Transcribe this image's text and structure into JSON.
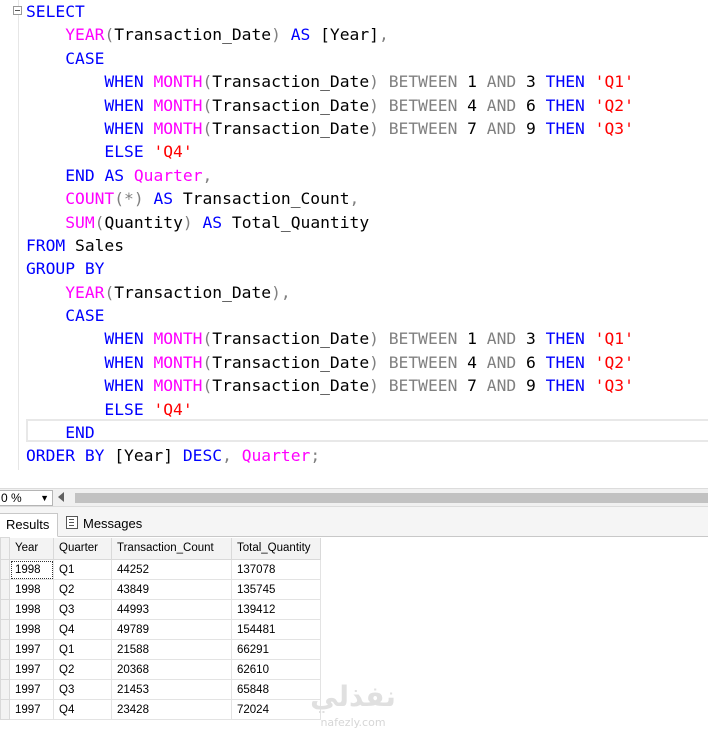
{
  "editor": {
    "lines": [
      [
        {
          "t": "SELECT",
          "c": "kw"
        }
      ],
      [
        {
          "t": "    "
        },
        {
          "t": "YEAR",
          "c": "fn"
        },
        {
          "t": "(",
          "c": "op"
        },
        {
          "t": "Transaction_Date"
        },
        {
          "t": ")",
          "c": "op"
        },
        {
          "t": " "
        },
        {
          "t": "AS",
          "c": "kw"
        },
        {
          "t": " [Year]"
        },
        {
          "t": ",",
          "c": "op"
        }
      ],
      [
        {
          "t": "    "
        },
        {
          "t": "CASE",
          "c": "kw"
        }
      ],
      [
        {
          "t": "        "
        },
        {
          "t": "WHEN",
          "c": "kw"
        },
        {
          "t": " "
        },
        {
          "t": "MONTH",
          "c": "fn"
        },
        {
          "t": "(",
          "c": "op"
        },
        {
          "t": "Transaction_Date"
        },
        {
          "t": ")",
          "c": "op"
        },
        {
          "t": " "
        },
        {
          "t": "BETWEEN",
          "c": "op"
        },
        {
          "t": " 1 "
        },
        {
          "t": "AND",
          "c": "op"
        },
        {
          "t": " 3 "
        },
        {
          "t": "THEN",
          "c": "kw"
        },
        {
          "t": " "
        },
        {
          "t": "'Q1'",
          "c": "str"
        }
      ],
      [
        {
          "t": "        "
        },
        {
          "t": "WHEN",
          "c": "kw"
        },
        {
          "t": " "
        },
        {
          "t": "MONTH",
          "c": "fn"
        },
        {
          "t": "(",
          "c": "op"
        },
        {
          "t": "Transaction_Date"
        },
        {
          "t": ")",
          "c": "op"
        },
        {
          "t": " "
        },
        {
          "t": "BETWEEN",
          "c": "op"
        },
        {
          "t": " 4 "
        },
        {
          "t": "AND",
          "c": "op"
        },
        {
          "t": " 6 "
        },
        {
          "t": "THEN",
          "c": "kw"
        },
        {
          "t": " "
        },
        {
          "t": "'Q2'",
          "c": "str"
        }
      ],
      [
        {
          "t": "        "
        },
        {
          "t": "WHEN",
          "c": "kw"
        },
        {
          "t": " "
        },
        {
          "t": "MONTH",
          "c": "fn"
        },
        {
          "t": "(",
          "c": "op"
        },
        {
          "t": "Transaction_Date"
        },
        {
          "t": ")",
          "c": "op"
        },
        {
          "t": " "
        },
        {
          "t": "BETWEEN",
          "c": "op"
        },
        {
          "t": " 7 "
        },
        {
          "t": "AND",
          "c": "op"
        },
        {
          "t": " 9 "
        },
        {
          "t": "THEN",
          "c": "kw"
        },
        {
          "t": " "
        },
        {
          "t": "'Q3'",
          "c": "str"
        }
      ],
      [
        {
          "t": "        "
        },
        {
          "t": "ELSE",
          "c": "kw"
        },
        {
          "t": " "
        },
        {
          "t": "'Q4'",
          "c": "str"
        }
      ],
      [
        {
          "t": "    "
        },
        {
          "t": "END",
          "c": "kw"
        },
        {
          "t": " "
        },
        {
          "t": "AS",
          "c": "kw"
        },
        {
          "t": " "
        },
        {
          "t": "Quarter",
          "c": "fn"
        },
        {
          "t": ",",
          "c": "op"
        }
      ],
      [
        {
          "t": "    "
        },
        {
          "t": "COUNT",
          "c": "fn"
        },
        {
          "t": "(*)",
          "c": "op"
        },
        {
          "t": " "
        },
        {
          "t": "AS",
          "c": "kw"
        },
        {
          "t": " Transaction_Count"
        },
        {
          "t": ",",
          "c": "op"
        }
      ],
      [
        {
          "t": "    "
        },
        {
          "t": "SUM",
          "c": "fn"
        },
        {
          "t": "(",
          "c": "op"
        },
        {
          "t": "Quantity"
        },
        {
          "t": ")",
          "c": "op"
        },
        {
          "t": " "
        },
        {
          "t": "AS",
          "c": "kw"
        },
        {
          "t": " Total_Quantity"
        }
      ],
      [
        {
          "t": "FROM",
          "c": "kw"
        },
        {
          "t": " Sales"
        }
      ],
      [
        {
          "t": "GROUP BY",
          "c": "kw"
        }
      ],
      [
        {
          "t": "    "
        },
        {
          "t": "YEAR",
          "c": "fn"
        },
        {
          "t": "(",
          "c": "op"
        },
        {
          "t": "Transaction_Date"
        },
        {
          "t": ")",
          "c": "op"
        },
        {
          "t": ",",
          "c": "op"
        }
      ],
      [
        {
          "t": "    "
        },
        {
          "t": "CASE",
          "c": "kw"
        }
      ],
      [
        {
          "t": "        "
        },
        {
          "t": "WHEN",
          "c": "kw"
        },
        {
          "t": " "
        },
        {
          "t": "MONTH",
          "c": "fn"
        },
        {
          "t": "(",
          "c": "op"
        },
        {
          "t": "Transaction_Date"
        },
        {
          "t": ")",
          "c": "op"
        },
        {
          "t": " "
        },
        {
          "t": "BETWEEN",
          "c": "op"
        },
        {
          "t": " 1 "
        },
        {
          "t": "AND",
          "c": "op"
        },
        {
          "t": " 3 "
        },
        {
          "t": "THEN",
          "c": "kw"
        },
        {
          "t": " "
        },
        {
          "t": "'Q1'",
          "c": "str"
        }
      ],
      [
        {
          "t": "        "
        },
        {
          "t": "WHEN",
          "c": "kw"
        },
        {
          "t": " "
        },
        {
          "t": "MONTH",
          "c": "fn"
        },
        {
          "t": "(",
          "c": "op"
        },
        {
          "t": "Transaction_Date"
        },
        {
          "t": ")",
          "c": "op"
        },
        {
          "t": " "
        },
        {
          "t": "BETWEEN",
          "c": "op"
        },
        {
          "t": " 4 "
        },
        {
          "t": "AND",
          "c": "op"
        },
        {
          "t": " 6 "
        },
        {
          "t": "THEN",
          "c": "kw"
        },
        {
          "t": " "
        },
        {
          "t": "'Q2'",
          "c": "str"
        }
      ],
      [
        {
          "t": "        "
        },
        {
          "t": "WHEN",
          "c": "kw"
        },
        {
          "t": " "
        },
        {
          "t": "MONTH",
          "c": "fn"
        },
        {
          "t": "(",
          "c": "op"
        },
        {
          "t": "Transaction_Date"
        },
        {
          "t": ")",
          "c": "op"
        },
        {
          "t": " "
        },
        {
          "t": "BETWEEN",
          "c": "op"
        },
        {
          "t": " 7 "
        },
        {
          "t": "AND",
          "c": "op"
        },
        {
          "t": " 9 "
        },
        {
          "t": "THEN",
          "c": "kw"
        },
        {
          "t": " "
        },
        {
          "t": "'Q3'",
          "c": "str"
        }
      ],
      [
        {
          "t": "        "
        },
        {
          "t": "ELSE",
          "c": "kw"
        },
        {
          "t": " "
        },
        {
          "t": "'Q4'",
          "c": "str"
        }
      ],
      [
        {
          "t": "    "
        },
        {
          "t": "END",
          "c": "kw"
        }
      ],
      [
        {
          "t": "ORDER BY",
          "c": "kw"
        },
        {
          "t": " [Year] "
        },
        {
          "t": "DESC",
          "c": "kw"
        },
        {
          "t": ",",
          "c": "op"
        },
        {
          "t": " "
        },
        {
          "t": "Quarter",
          "c": "fn"
        },
        {
          "t": ";",
          "c": "op"
        }
      ]
    ]
  },
  "zoom": {
    "value": "0 %"
  },
  "tabs": {
    "results_label": "Results",
    "messages_label": "Messages"
  },
  "results": {
    "columns": [
      "Year",
      "Quarter",
      "Transaction_Count",
      "Total_Quantity"
    ],
    "rows": [
      [
        "1998",
        "Q1",
        "44252",
        "137078"
      ],
      [
        "1998",
        "Q2",
        "43849",
        "135745"
      ],
      [
        "1998",
        "Q3",
        "44993",
        "139412"
      ],
      [
        "1998",
        "Q4",
        "49789",
        "154481"
      ],
      [
        "1997",
        "Q1",
        "21588",
        "66291"
      ],
      [
        "1997",
        "Q2",
        "20368",
        "62610"
      ],
      [
        "1997",
        "Q3",
        "21453",
        "65848"
      ],
      [
        "1997",
        "Q4",
        "23428",
        "72024"
      ]
    ]
  },
  "watermark": {
    "text": "نفذلي",
    "sub": "nafezly.com"
  },
  "colors": {
    "keyword": "#0000ff",
    "function": "#ff00ff",
    "operator": "#808080",
    "string": "#ff0000"
  }
}
